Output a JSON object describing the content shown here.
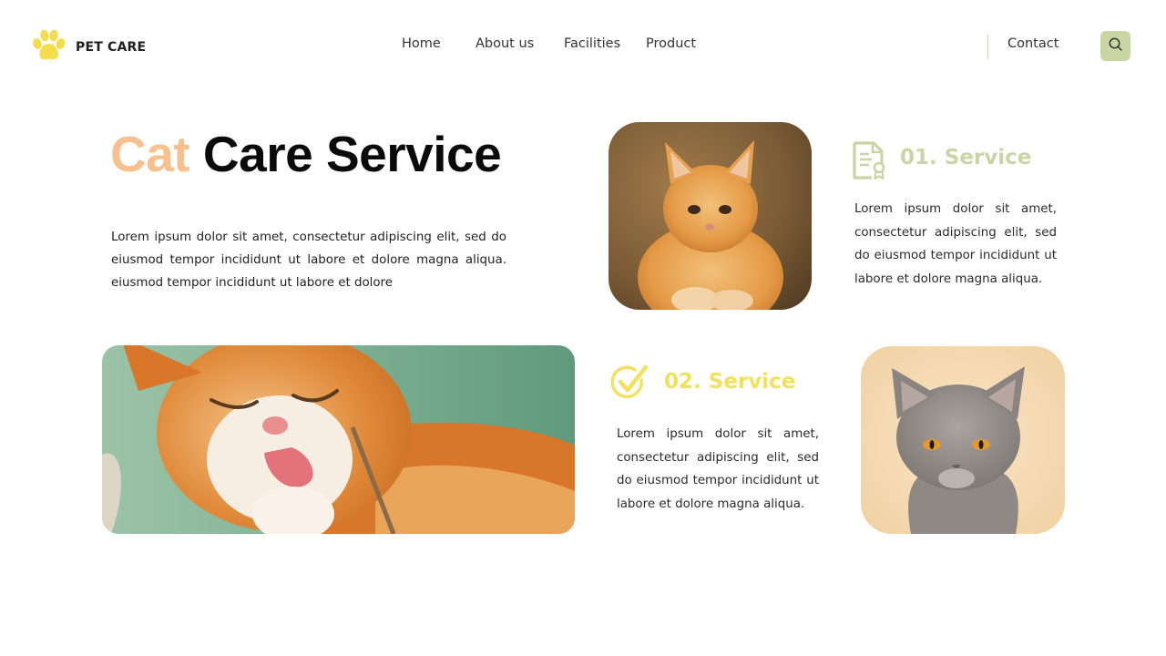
{
  "header": {
    "brand": "PET CARE",
    "nav": [
      "Home",
      "About us",
      "Facilities",
      "Product"
    ],
    "contact": "Contact",
    "search_icon": "search-icon",
    "logo_icon": "paw-icon"
  },
  "hero": {
    "title_accent": "Cat",
    "title_rest": "Care Service",
    "text": "Lorem ipsum dolor sit amet, consectetur adipiscing elit, sed do eiusmod tempor incididunt ut labore et dolore magna aliqua. eiusmod tempor incididunt ut labore et dolore"
  },
  "services": [
    {
      "title": "01. Service",
      "text": "Lorem ipsum dolor sit amet, consectetur adipiscing elit, sed do eiusmod tempor incididunt ut labore et dolore magna aliqua.",
      "icon": "certificate-icon"
    },
    {
      "title": "02. Service",
      "text": "Lorem ipsum dolor sit amet, consectetur adipiscing elit, sed do eiusmod tempor incididunt ut labore et dolore magna aliqua.",
      "icon": "check-circle-icon"
    }
  ],
  "colors": {
    "accent_peach": "#f8c08e",
    "accent_sage": "#c9d6a4",
    "accent_yellow": "#f2e15a",
    "logo_yellow": "#f5dc4a"
  }
}
